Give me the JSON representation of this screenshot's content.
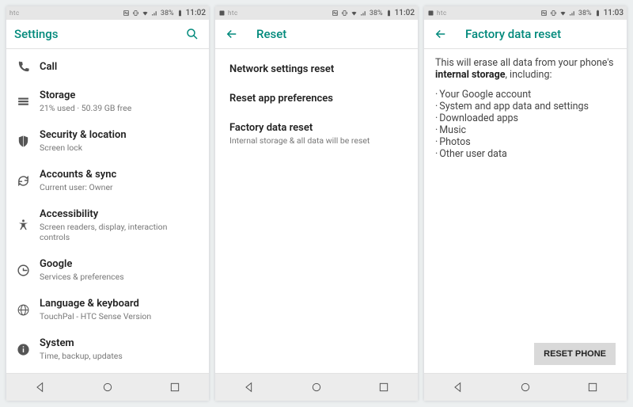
{
  "accent": "#00897b",
  "screen1": {
    "status": {
      "brand": "htc",
      "battery": "38%",
      "time": "11:02"
    },
    "title": "Settings",
    "items": [
      {
        "icon": "call",
        "title": "Call",
        "sub": ""
      },
      {
        "icon": "storage",
        "title": "Storage",
        "sub": "21% used · 50.39 GB free"
      },
      {
        "icon": "shield",
        "title": "Security & location",
        "sub": "Screen lock"
      },
      {
        "icon": "sync",
        "title": "Accounts & sync",
        "sub": "Current user: Owner"
      },
      {
        "icon": "access",
        "title": "Accessibility",
        "sub": "Screen readers, display, interaction controls"
      },
      {
        "icon": "google",
        "title": "Google",
        "sub": "Services & preferences"
      },
      {
        "icon": "globe",
        "title": "Language & keyboard",
        "sub": "TouchPal - HTC Sense Version"
      },
      {
        "icon": "info",
        "title": "System",
        "sub": "Time, backup, updates"
      }
    ]
  },
  "screen2": {
    "status": {
      "brand": "htc",
      "battery": "38%",
      "time": "11:02"
    },
    "title": "Reset",
    "items": [
      {
        "title": "Network settings reset",
        "sub": ""
      },
      {
        "title": "Reset app preferences",
        "sub": ""
      },
      {
        "title": "Factory data reset",
        "sub": "Internal storage & all data will be reset"
      }
    ]
  },
  "screen3": {
    "status": {
      "brand": "htc",
      "battery": "38%",
      "time": "11:03"
    },
    "title": "Factory data reset",
    "intro_line1": "This will erase all data from your phone's",
    "intro_strong": "internal storage",
    "intro_after": ", including:",
    "bullets": [
      "Your Google account",
      "System and app data and settings",
      "Downloaded apps",
      "Music",
      "Photos",
      "Other user data"
    ],
    "button": "RESET PHONE"
  }
}
